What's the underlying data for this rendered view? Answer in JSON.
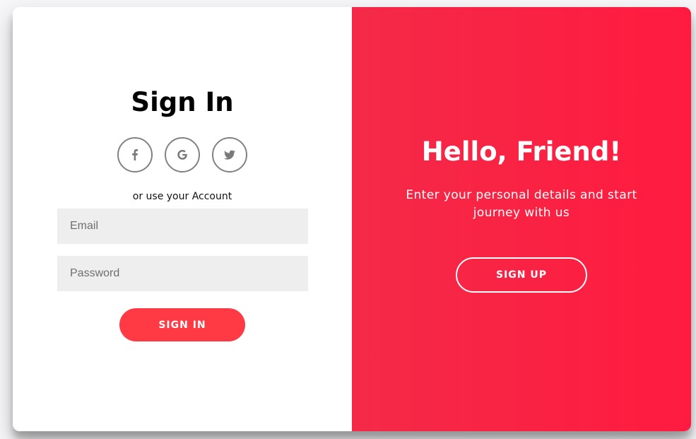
{
  "signin": {
    "title": "Sign In",
    "social_icons": [
      "facebook-icon",
      "google-icon",
      "twitter-icon"
    ],
    "or_text": "or use your Account",
    "email_placeholder": "Email",
    "password_placeholder": "Password",
    "button_label": "SIGN IN"
  },
  "overlay": {
    "title": "Hello, Friend!",
    "text": "Enter your personal details and start journey with us",
    "button_label": "SIGN UP"
  },
  "colors": {
    "accent": "#ff1b3f",
    "button": "#ff3a45",
    "input_bg": "#eeeeee"
  }
}
